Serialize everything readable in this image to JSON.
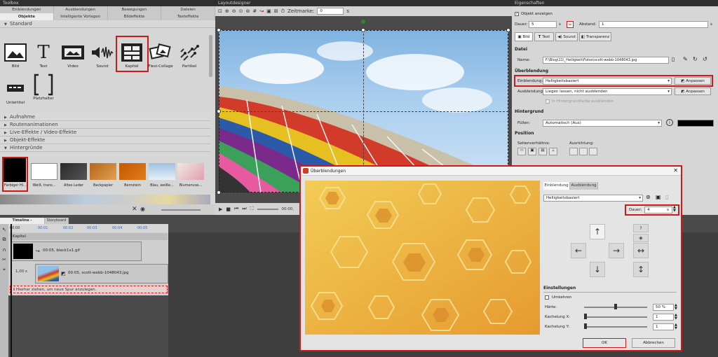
{
  "toolbox": {
    "title": "Toolbox",
    "tabs_top": [
      "Einblendungen",
      "Ausblendungen",
      "Bewegungen",
      "Dateien"
    ],
    "tabs_bottom": [
      "Objekte",
      "Intelligente Vorlagen",
      "Bildeffekte",
      "Texteffekte"
    ],
    "section_standard": "Standard",
    "tools": [
      "Bild",
      "Text",
      "Video",
      "Sound",
      "Kapitel",
      "Flexi-Collage",
      "Partikel",
      "Untertitel",
      "Platzhalter"
    ],
    "sections": [
      "Aufnahme",
      "Routenanimationen",
      "Live-Effekte / Video-Effekte",
      "Objekt-Effekte",
      "Hintergründe"
    ],
    "backgrounds": [
      "Farbiger Hi...",
      "Weiß, trans...",
      "Altes Leder",
      "Backpapier",
      "Bernstein",
      "Blau, weiße...",
      "Blumenvas..."
    ]
  },
  "layout": {
    "title": "Layoutdesigner",
    "zeitmarke_label": "Zeitmarke:",
    "zeitmarke_value": "0",
    "zeitmarke_unit": "s",
    "time_readout": "00:00,"
  },
  "props": {
    "title": "Eigenschaften",
    "objekt_anzeigen": "Objekt anzeigen",
    "dauer_label": "Dauer:",
    "dauer_value": "5",
    "dauer_unit": "s",
    "abstand_label": "Abstand:",
    "abstand_value": "1",
    "abstand_unit": "s",
    "tabs": [
      "Bild",
      "Text",
      "Sound",
      "Transparenz"
    ],
    "datei_hdr": "Datei",
    "name_label": "Name:",
    "name_value": "F:\\Blog\\11\\_Helligkeit\\Fotos\\scott-webb-1048043.jpg",
    "ueberblendung_hdr": "Überblendung",
    "einblendung_label": "Einblendung:",
    "einblendung_value": "Helligkeitsbasiert",
    "ausblendung_label": "Ausblendung:",
    "ausblendung_value": "Liegen lassen, nicht ausblenden",
    "anpassen": "Anpassen",
    "hintergrund_checkbox": "In Hintergrundfarbe ausblenden",
    "hintergrund_hdr": "Hintergrund",
    "fuellen_label": "Füllen:",
    "fuellen_value": "Automatisch (Aus)",
    "position_hdr": "Position",
    "seitenverhaeltnis": "Seitenverhältnis:",
    "ausrichtung": "Ausrichtung:"
  },
  "timeline": {
    "tabs": [
      "Timeline - Spuransicht",
      "Storyboard"
    ],
    "ruler": [
      "00:00",
      "00:01",
      "00:02",
      "00:03",
      "00:04",
      "00:05"
    ],
    "kapitel_label": "Kapitel",
    "clip1": "00:05, black1x1.gif",
    "clip2_duration": "1,00 s",
    "clip2": "00:05, scott-webb-1048043.jpg",
    "drop_hint": "Hierher ziehen, um neue Spur anzulegen."
  },
  "dialog": {
    "title": "Überblendungen",
    "tabs": [
      "Einblendung",
      "Ausblendung"
    ],
    "select_value": "Helligkeitsbasiert",
    "dauer_label": "Dauer:",
    "dauer_value": "4",
    "dauer_unit": "s",
    "einstellungen_hdr": "Einstellungen",
    "umkehren": "Umkehren",
    "haerte_label": "Härte:",
    "haerte_value": "50 %",
    "kachelung_x_label": "Kachelung X:",
    "kachelung_x_value": "1",
    "kachelung_y_label": "Kachelung Y:",
    "kachelung_y_value": "1",
    "ok": "OK",
    "abbrechen": "Abbrechen"
  },
  "colors": {
    "highlight": "#d01a1a",
    "panel_bg": "#d6d6d6",
    "dark_bg": "#3a3a3a"
  }
}
